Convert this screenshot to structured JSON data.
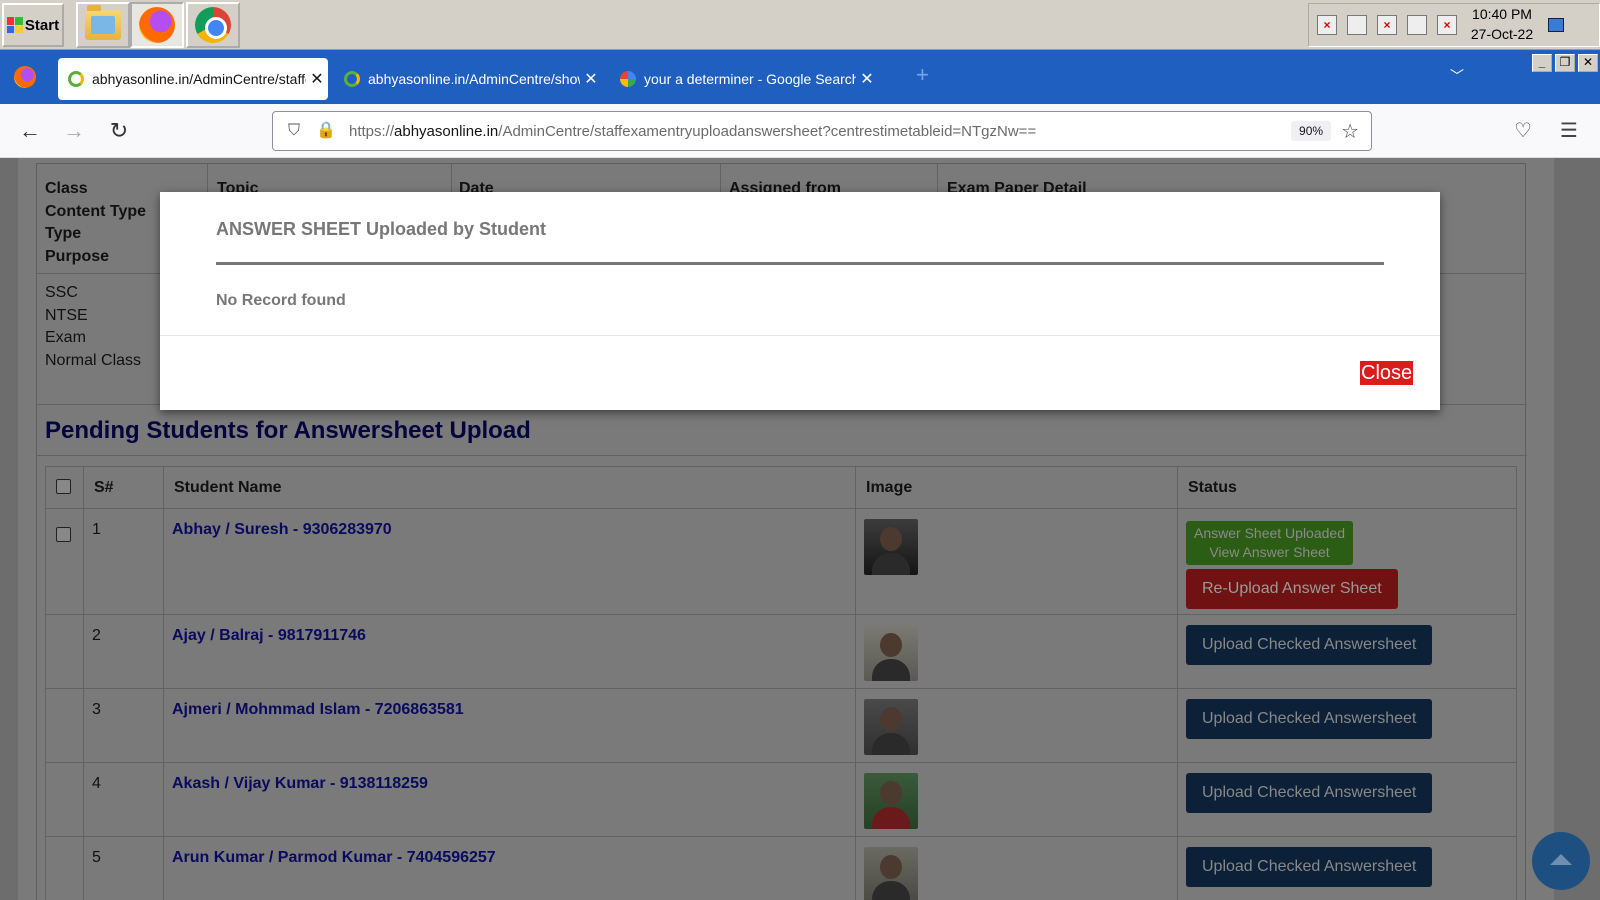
{
  "taskbar": {
    "start_label": "Start",
    "clock_time": "10:40 PM",
    "clock_date": "27-Oct-22"
  },
  "browser": {
    "tabs": [
      {
        "title": "abhyasonline.in/AdminCentre/staffexamentry",
        "active": true
      },
      {
        "title": "abhyasonline.in/AdminCentre/showanswersheet",
        "active": false
      },
      {
        "title": "your a determiner - Google Search",
        "active": false
      }
    ],
    "url_prefix": "https://",
    "url_domain": "abhyasonline.in",
    "url_path": "/AdminCentre/staffexamentryuploadanswersheet?centrestimetableid=NTgzNw==",
    "zoom": "90%"
  },
  "info": {
    "headers_col1": [
      "Class",
      "Content Type",
      "Type",
      "Purpose"
    ],
    "col_topic": "Topic",
    "col_date": "Date",
    "col_assigned": "Assigned from",
    "col_exam_detail": "Exam Paper Detail",
    "values_col1": [
      "SSC",
      "NTSE",
      "Exam",
      "Normal Class"
    ]
  },
  "pending": {
    "title": "Pending Students for Answersheet Upload",
    "columns": {
      "serial": "S#",
      "name": "Student Name",
      "image": "Image",
      "status": "Status"
    },
    "rows": [
      {
        "sn": "1",
        "name": "Abhay / Suresh - 9306283970",
        "uploaded_label_1": "Answer Sheet Uploaded",
        "uploaded_label_2": "View Answer Sheet",
        "reupload_label": "Re-Upload Answer Sheet"
      },
      {
        "sn": "2",
        "name": "Ajay / Balraj - 9817911746",
        "action_label": "Upload Checked Answersheet"
      },
      {
        "sn": "3",
        "name": "Ajmeri / Mohmmad Islam - 7206863581",
        "action_label": "Upload Checked Answersheet"
      },
      {
        "sn": "4",
        "name": "Akash / Vijay Kumar - 9138118259",
        "action_label": "Upload Checked Answersheet"
      },
      {
        "sn": "5",
        "name": "Arun Kumar / Parmod Kumar - 7404596257",
        "action_label": "Upload Checked Answersheet"
      }
    ]
  },
  "modal": {
    "title": "ANSWER SHEET Uploaded by Student",
    "body": "No Record found",
    "close_label": "Close"
  }
}
